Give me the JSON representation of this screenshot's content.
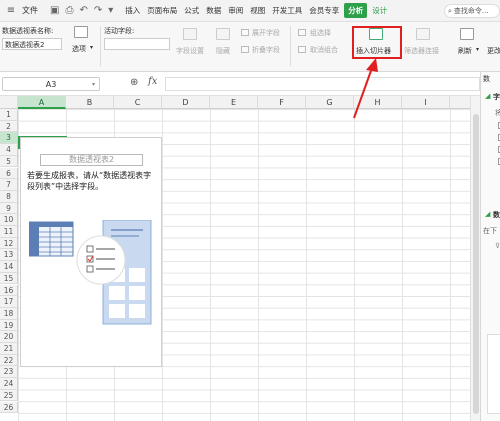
{
  "menubar": {
    "hamburger": "≡",
    "file_label": "文件",
    "tabs": [
      {
        "label": "插入"
      },
      {
        "label": "页面布局"
      },
      {
        "label": "公式"
      },
      {
        "label": "数据"
      },
      {
        "label": "审阅"
      },
      {
        "label": "视图"
      },
      {
        "label": "开发工具"
      },
      {
        "label": "会员专享"
      }
    ],
    "active_tab": "分析",
    "design_tab": "设计",
    "search_text": "查找命令..."
  },
  "ribbon": {
    "pivot_name_label": "数据透视表名称:",
    "pivot_name_value": "数据透视表2",
    "options_label": "选项",
    "active_field_label": "活动字段:",
    "field_settings": "字段设置",
    "hide": "隐藏",
    "expand_field": "展开字段",
    "collapse_field": "折叠字段",
    "group_selection": "组选择",
    "ungroup": "取消组合",
    "insert_slicer": "插入切片器",
    "filter_connection": "筛选器连接",
    "refresh": "刷新",
    "change_source": "更改"
  },
  "formula_bar": {
    "name_box": "A3",
    "fx": "fx"
  },
  "sheet": {
    "columns": [
      "A",
      "B",
      "C",
      "D",
      "E",
      "F",
      "G",
      "H",
      "I"
    ],
    "rows": [
      "1",
      "2",
      "3",
      "4",
      "5",
      "6",
      "7",
      "8",
      "9",
      "10",
      "11",
      "12",
      "13",
      "14",
      "15",
      "16",
      "17",
      "18",
      "19",
      "20",
      "21",
      "22",
      "23",
      "24",
      "25",
      "26"
    ]
  },
  "pivot": {
    "title": "数据透视表2",
    "hint": "若要生成报表，请从“数据透视表字段列表”中选择字段。"
  },
  "right_panel": {
    "heading1": "字",
    "sub1": "将",
    "heading2": "数",
    "sub2": "在下"
  },
  "colors": {
    "accent_green": "#2ea04a",
    "highlight_red": "#e02020"
  }
}
